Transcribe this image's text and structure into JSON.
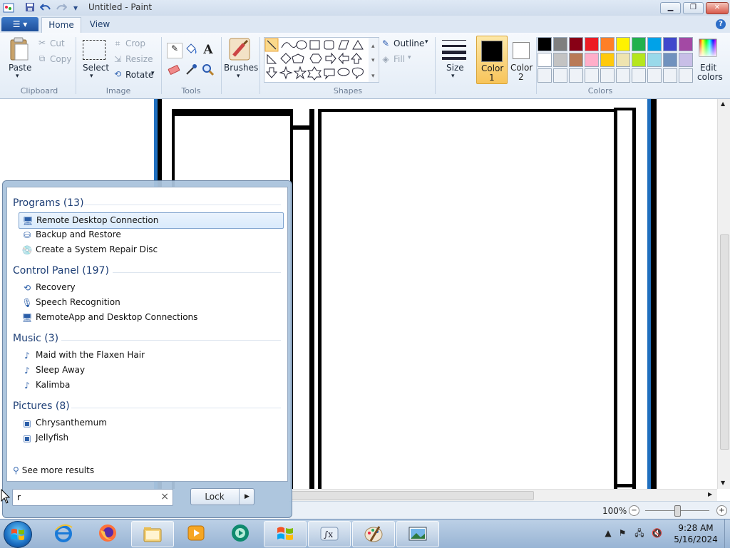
{
  "window": {
    "title": "Untitled - Paint"
  },
  "tabs": {
    "app_menu": "▾",
    "home": "Home",
    "view": "View",
    "help": "?"
  },
  "ribbon": {
    "clipboard": {
      "paste": "Paste",
      "cut": "Cut",
      "copy": "Copy",
      "label": "Clipboard"
    },
    "image": {
      "select": "Select",
      "crop": "Crop",
      "resize": "Resize",
      "rotate": "Rotate",
      "label": "Image"
    },
    "tools": {
      "label": "Tools"
    },
    "brushes": {
      "label": "Brushes"
    },
    "shapes": {
      "outline": "Outline",
      "fill": "Fill",
      "label": "Shapes"
    },
    "size": {
      "label": "Size"
    },
    "color1": {
      "line1": "Color",
      "line2": "1",
      "value": "#000000"
    },
    "color2": {
      "line1": "Color",
      "line2": "2",
      "value": "#ffffff"
    },
    "colors": {
      "label": "Colors",
      "palette_row1": [
        "#000000",
        "#7f7f7f",
        "#880015",
        "#ed1c24",
        "#ff7f27",
        "#fff200",
        "#22b14c",
        "#00a2e8",
        "#3f48cc",
        "#a349a4"
      ],
      "palette_row2": [
        "#ffffff",
        "#c3c3c3",
        "#b97a57",
        "#ffaec9",
        "#ffc90e",
        "#efe4b0",
        "#b5e61d",
        "#99d9ea",
        "#7092be",
        "#c8bfe7"
      ],
      "edit_line1": "Edit",
      "edit_line2": "colors"
    }
  },
  "status": {
    "zoom": "100%",
    "zoom_level_percent": 100
  },
  "start_menu": {
    "programs_header": "Programs (13)",
    "programs": [
      {
        "label": "Remote Desktop Connection",
        "icon": "remote-desktop-icon",
        "selected": true
      },
      {
        "label": "Backup and Restore",
        "icon": "backup-icon"
      },
      {
        "label": "Create a System Repair Disc",
        "icon": "repair-disc-icon"
      }
    ],
    "control_panel_header": "Control Panel (197)",
    "control_panel": [
      {
        "label": "Recovery",
        "icon": "recovery-icon"
      },
      {
        "label": "Speech Recognition",
        "icon": "microphone-icon"
      },
      {
        "label": "RemoteApp and Desktop Connections",
        "icon": "remoteapp-icon"
      }
    ],
    "music_header": "Music (3)",
    "music": [
      {
        "label": "Maid with the Flaxen Hair",
        "icon": "music-file-icon"
      },
      {
        "label": "Sleep Away",
        "icon": "music-file-icon"
      },
      {
        "label": "Kalimba",
        "icon": "music-file-icon"
      }
    ],
    "pictures_header": "Pictures (8)",
    "pictures": [
      {
        "label": "Chrysanthemum",
        "icon": "image-file-icon"
      },
      {
        "label": "Jellyfish",
        "icon": "image-file-icon"
      }
    ],
    "see_more": "See more results",
    "search_value": "r",
    "search_clear": "×",
    "lock": "Lock",
    "lock_arrow": "▶"
  },
  "taskbar": {
    "time": "9:28 AM",
    "date": "5/16/2024"
  }
}
